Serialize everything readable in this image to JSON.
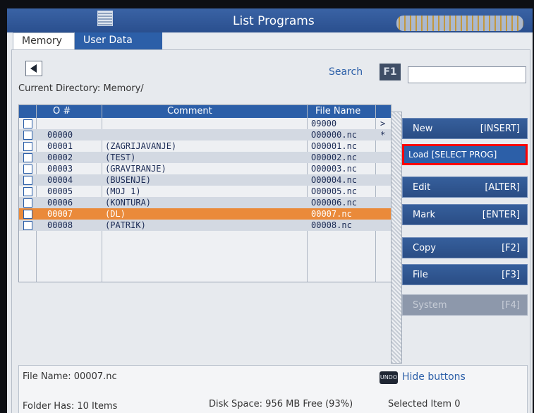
{
  "window": {
    "title": "List Programs"
  },
  "tabs": [
    {
      "label": "Memory",
      "active": true
    },
    {
      "label": "User Data",
      "active": false
    }
  ],
  "current_directory": "Current Directory: Memory/",
  "search": {
    "label": "Search",
    "hotkey": "F1",
    "value": ""
  },
  "table": {
    "columns": [
      "O #",
      "Comment",
      "File Name"
    ],
    "rows": [
      {
        "onum": "",
        "comment": "",
        "file": "09000",
        "flag": ">"
      },
      {
        "onum": "00000",
        "comment": "",
        "file": "O00000.nc",
        "flag": "*"
      },
      {
        "onum": "00001",
        "comment": "(ZAGRIJAVANJE)",
        "file": "O00001.nc",
        "flag": ""
      },
      {
        "onum": "00002",
        "comment": "(TEST)",
        "file": "O00002.nc",
        "flag": ""
      },
      {
        "onum": "00003",
        "comment": "(GRAVIRANJE)",
        "file": "O00003.nc",
        "flag": ""
      },
      {
        "onum": "00004",
        "comment": "(BUSENJE)",
        "file": "O00004.nc",
        "flag": ""
      },
      {
        "onum": "00005",
        "comment": "(MOJ 1)",
        "file": "O00005.nc",
        "flag": ""
      },
      {
        "onum": "00006",
        "comment": "(KONTURA)",
        "file": "O00006.nc",
        "flag": ""
      },
      {
        "onum": "00007",
        "comment": "(DL)",
        "file": "00007.nc",
        "flag": "",
        "selected": true
      },
      {
        "onum": "00008",
        "comment": "(PATRIK)",
        "file": "00008.nc",
        "flag": ""
      }
    ]
  },
  "side_buttons": [
    {
      "label": "New",
      "key": "[INSERT]"
    },
    {
      "label": "Load [SELECT PROG]",
      "key": ""
    },
    {
      "label": "Edit",
      "key": "[ALTER]"
    },
    {
      "label": "Mark",
      "key": "[ENTER]"
    },
    {
      "label": "Copy",
      "key": "[F2]"
    },
    {
      "label": "File",
      "key": "[F3]"
    },
    {
      "label": "System",
      "key": "[F4]"
    }
  ],
  "footer": {
    "file_name": "File Name: 00007.nc",
    "undo_label": "UNDO",
    "hide_buttons": "Hide buttons",
    "folder_has": "Folder Has: 10 Items",
    "disk_space": "Disk Space: 956 MB Free (93%)",
    "selected_items": "Selected Item 0"
  },
  "colors": {
    "accent": "#2c5fa8",
    "selection": "#ea8a3a",
    "highlight_box": "#ff0000"
  }
}
